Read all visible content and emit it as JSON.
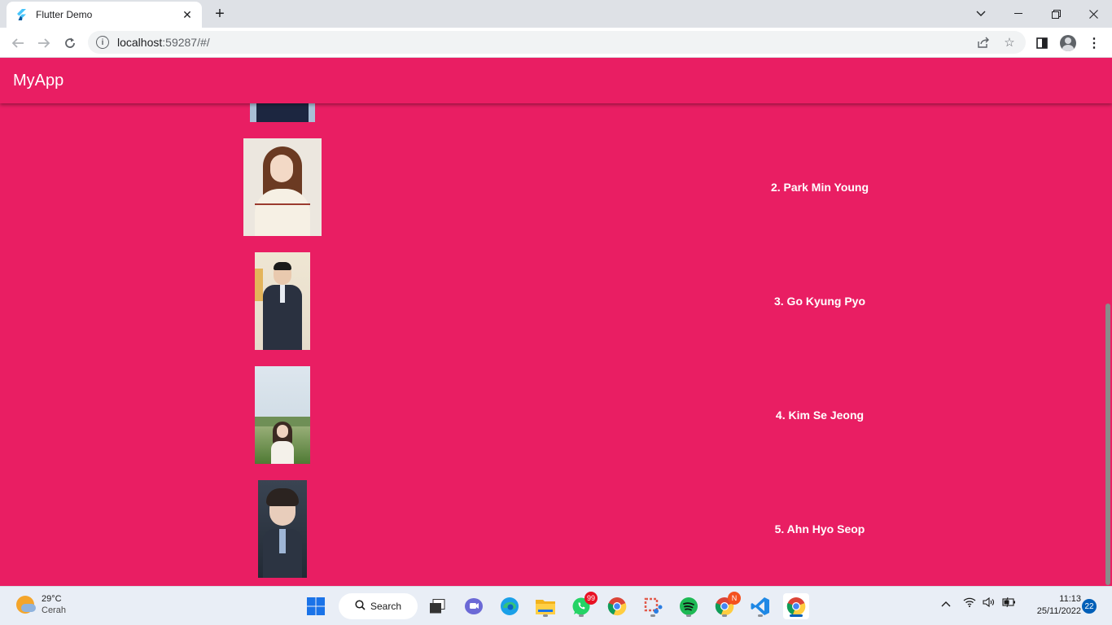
{
  "browser": {
    "tab_title": "Flutter Demo",
    "url_host": "localhost",
    "url_rest": ":59287/#/"
  },
  "app": {
    "title": "MyApp",
    "background_color": "#e91e63",
    "items": [
      {
        "name": "2. Park Min Young"
      },
      {
        "name": "3. Go Kyung Pyo"
      },
      {
        "name": "4. Kim Se Jeong"
      },
      {
        "name": "5. Ahn Hyo Seop"
      }
    ]
  },
  "taskbar": {
    "weather_temp": "29°C",
    "weather_condition": "Cerah",
    "search_label": "Search",
    "whatsapp_badge": "99",
    "chrome_profile_badge": "N",
    "time": "11:13",
    "date": "25/11/2022",
    "notification_count": "22"
  }
}
